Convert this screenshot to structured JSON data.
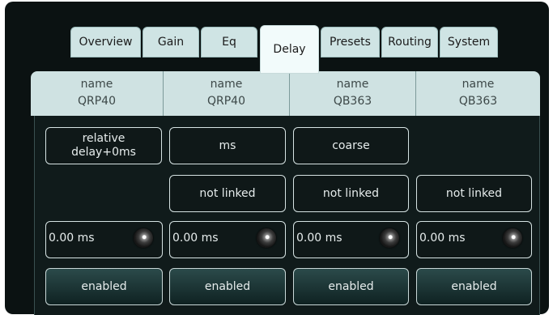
{
  "tabs": [
    {
      "label": "Overview",
      "active": false
    },
    {
      "label": "Gain",
      "active": false
    },
    {
      "label": "Eq",
      "active": false
    },
    {
      "label": "Delay",
      "active": true
    },
    {
      "label": "Presets",
      "active": false
    },
    {
      "label": "Routing",
      "active": false
    },
    {
      "label": "System",
      "active": false
    }
  ],
  "channels": [
    {
      "name_label": "name",
      "name_value": "QRP40"
    },
    {
      "name_label": "name",
      "name_value": "QRP40"
    },
    {
      "name_label": "name",
      "name_value": "QB363"
    },
    {
      "name_label": "name",
      "name_value": "QB363"
    }
  ],
  "mode_buttons": [
    "relative\ndelay+0ms",
    "ms",
    "coarse"
  ],
  "link_buttons": [
    "not linked",
    "not linked",
    "not linked"
  ],
  "delay_values": [
    "0.00 ms",
    "0.00 ms",
    "0.00 ms",
    "0.00 ms"
  ],
  "enable_buttons": [
    "enabled",
    "enabled",
    "enabled",
    "enabled"
  ],
  "colors": {
    "panel": "#101b1b",
    "tab": "#cfe4e4",
    "active_tab": "#f2fbfb",
    "header": "#cfe2e2"
  }
}
